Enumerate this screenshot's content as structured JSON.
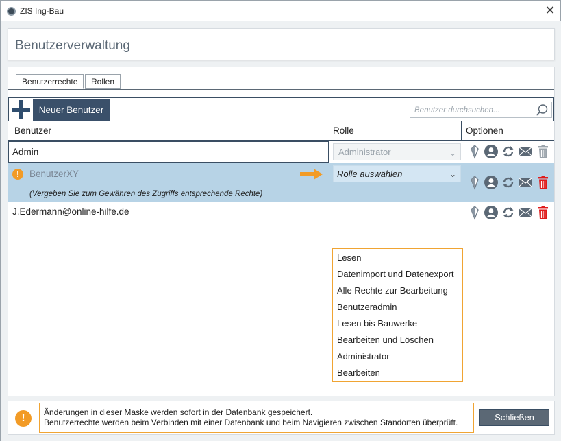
{
  "window": {
    "title": "ZIS Ing-Bau",
    "close_glyph": "✕"
  },
  "header": {
    "title": "Benutzerverwaltung"
  },
  "tabs": [
    {
      "label": "Benutzerrechte",
      "active": true
    },
    {
      "label": "Rollen",
      "active": false
    }
  ],
  "toolbar": {
    "new_user_label": "Neuer Benutzer",
    "search_placeholder": "Benutzer durchsuchen..."
  },
  "columns": {
    "user": "Benutzer",
    "role": "Rolle",
    "options": "Optionen"
  },
  "rows": [
    {
      "user": "Admin",
      "role": "Administrator",
      "editing": true
    },
    {
      "user": "BenutzerXY",
      "role": "Rolle auswählen",
      "hint": "(Vergeben Sie zum Gewähren des Zugriffs entsprechende Rechte)",
      "warning": true,
      "selected": true
    },
    {
      "user": "J.Edermann@online-hilfe.de",
      "role": ""
    }
  ],
  "option_icons": [
    "gem-icon",
    "user-circle-icon",
    "refresh-icon",
    "mail-icon",
    "trash-icon"
  ],
  "role_dropdown": {
    "options": [
      "Lesen",
      "Datenimport und Datenexport",
      "Alle Rechte zur Bearbeitung",
      "Benutzeradmin",
      "Lesen bis Bauwerke",
      "Bearbeiten und Löschen",
      "Administrator",
      "Bearbeiten"
    ]
  },
  "footer": {
    "message_line1": "Änderungen in dieser Maske werden sofort in der Datenbank gespeichert.",
    "message_line2": "Benutzerrechte werden beim Verbinden mit einer Datenbank und beim Navigieren zwischen Standorten überprüft.",
    "close_label": "Schließen",
    "warning_glyph": "!"
  },
  "colors": {
    "accent": "#3a506a",
    "warning": "#f29b26",
    "selected_row": "#b7d3e6",
    "delete_red": "#e01b1b"
  }
}
